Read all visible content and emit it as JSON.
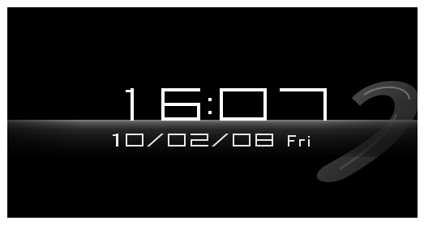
{
  "clock": {
    "time": "16:07",
    "date": "10/02/08 Fri"
  }
}
